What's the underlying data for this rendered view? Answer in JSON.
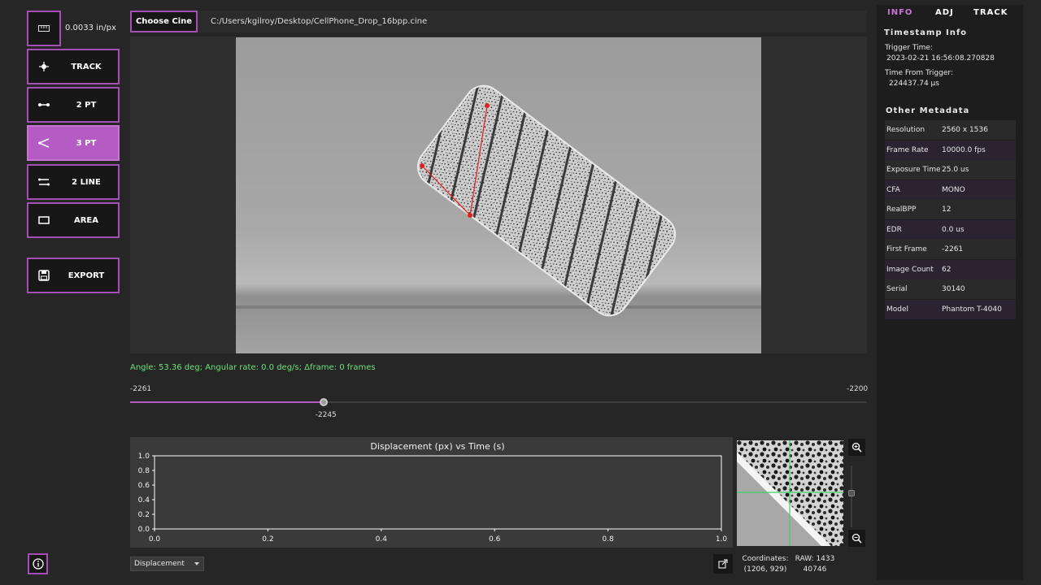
{
  "scale": {
    "value": "0.0033 in/px"
  },
  "tools": [
    {
      "label": "TRACK",
      "icon": "crosshair-icon",
      "active": false
    },
    {
      "label": "2 PT",
      "icon": "two-point-icon",
      "active": false
    },
    {
      "label": "3 PT",
      "icon": "angle-icon",
      "active": true
    },
    {
      "label": "2 LINE",
      "icon": "two-line-icon",
      "active": false
    },
    {
      "label": "AREA",
      "icon": "rectangle-icon",
      "active": false
    }
  ],
  "export": {
    "label": "EXPORT"
  },
  "header": {
    "choose_label": "Choose Cine",
    "file_path": "C:/Users/kgilroy/Desktop/CellPhone_Drop_16bpp.cine"
  },
  "status": {
    "text": "Angle: 53.36 deg; Angular rate: 0.0 deg/s; Δframe: 0 frames"
  },
  "timeline": {
    "min_label": "-2261",
    "max_label": "-2200",
    "min": -2261,
    "max": -2200,
    "current": -2245,
    "current_label": "-2245"
  },
  "plot": {
    "dropdown_value": "Displacement"
  },
  "chart_data": {
    "type": "line",
    "title": "Displacement (px) vs Time (s)",
    "xlabel": "",
    "ylabel": "",
    "xlim": [
      0.0,
      1.0
    ],
    "ylim": [
      0.0,
      1.0
    ],
    "x_ticks": [
      "0.0",
      "0.2",
      "0.4",
      "0.6",
      "0.8",
      "1.0"
    ],
    "y_ticks": [
      "0.0",
      "0.2",
      "0.4",
      "0.6",
      "0.8",
      "1.0"
    ],
    "series": []
  },
  "zoom": {
    "coords_label": "Coordinates:",
    "coords_value": "(1206, 929)",
    "raw_label": "RAW: 1433",
    "raw_value": "40746"
  },
  "panel": {
    "tabs": [
      {
        "label": "INFO",
        "active": true
      },
      {
        "label": "ADJ",
        "active": false
      },
      {
        "label": "TRACK",
        "active": false
      }
    ],
    "timestamp_title": "Timestamp Info",
    "trigger_time_label": "Trigger Time:",
    "trigger_time_value": "2023-02-21 16:56:08.270828",
    "from_trigger_label": "Time From Trigger:",
    "from_trigger_value": "224437.74 μs",
    "metadata_title": "Other Metadata",
    "metadata": [
      {
        "key": "Resolution",
        "value": "2560 x 1536"
      },
      {
        "key": "Frame Rate",
        "value": "10000.0 fps"
      },
      {
        "key": "Exposure Time",
        "value": "25.0 us"
      },
      {
        "key": "CFA",
        "value": "MONO"
      },
      {
        "key": "RealBPP",
        "value": "12"
      },
      {
        "key": "EDR",
        "value": "0.0 us"
      },
      {
        "key": "First Frame",
        "value": "-2261"
      },
      {
        "key": "Image Count",
        "value": "62"
      },
      {
        "key": "Serial",
        "value": "30140"
      },
      {
        "key": "Model",
        "value": "Phantom T-4040"
      }
    ]
  },
  "colors": {
    "accent": "#b45cc4",
    "status_green": "#6ee27a",
    "marker_red": "#e02020"
  }
}
